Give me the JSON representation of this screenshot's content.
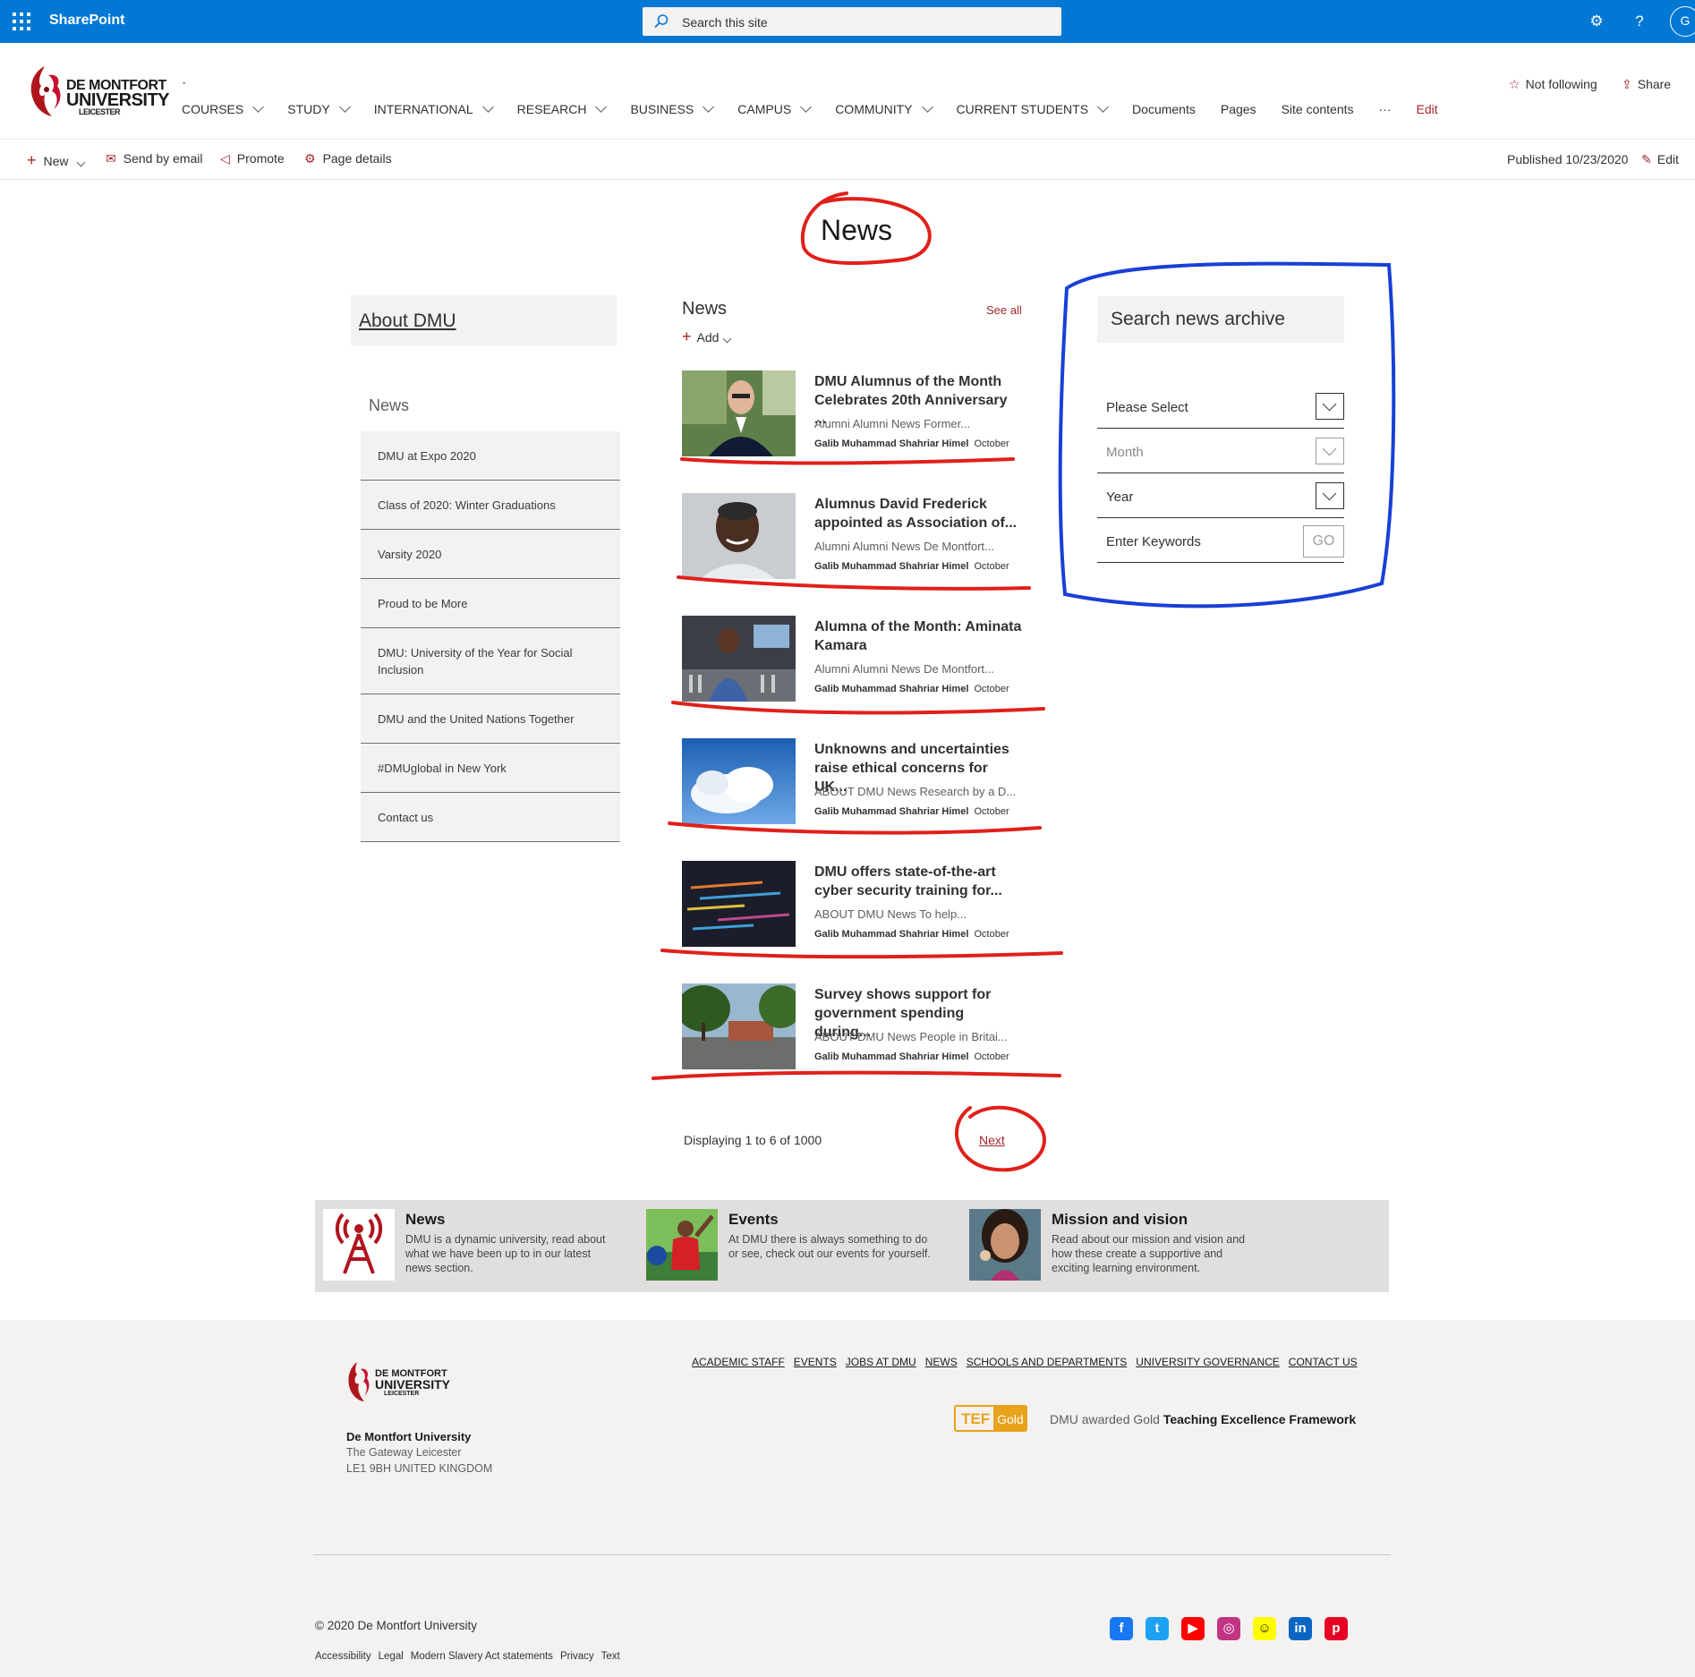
{
  "suite": {
    "app_name": "SharePoint",
    "search_placeholder": "Search this site",
    "settings_icon": "gear-icon",
    "help_label": "?",
    "avatar_initial": "G"
  },
  "site": {
    "logo_line1": "DE MONTFORT",
    "logo_line2": "UNIVERSITY",
    "logo_line3": "LEICESTER",
    "dot": "·",
    "nav": [
      {
        "label": "COURSES",
        "dropdown": true
      },
      {
        "label": "STUDY",
        "dropdown": true
      },
      {
        "label": "INTERNATIONAL",
        "dropdown": true
      },
      {
        "label": "RESEARCH",
        "dropdown": true
      },
      {
        "label": "BUSINESS",
        "dropdown": true
      },
      {
        "label": "CAMPUS",
        "dropdown": true
      },
      {
        "label": "COMMUNITY",
        "dropdown": true
      },
      {
        "label": "CURRENT STUDENTS",
        "dropdown": true
      },
      {
        "label": "Documents",
        "dropdown": false
      },
      {
        "label": "Pages",
        "dropdown": false
      },
      {
        "label": "Site contents",
        "dropdown": false
      },
      {
        "label": "···",
        "dropdown": false
      },
      {
        "label": "Edit",
        "dropdown": false
      }
    ],
    "follow_label": "Not following",
    "share_label": "Share"
  },
  "commandbar": {
    "new_label": "New",
    "email_label": "Send by email",
    "promote_label": "Promote",
    "details_label": "Page details",
    "published": "Published 10/23/2020",
    "edit_label": "Edit"
  },
  "page": {
    "title": "News"
  },
  "leftnav": {
    "about_label": "About DMU",
    "section_title": "News",
    "items": [
      "DMU at Expo 2020",
      "Class of 2020: Winter Graduations",
      "Varsity 2020",
      "Proud to be More",
      "DMU: University of the Year for Social Inclusion",
      "DMU and the United Nations Together",
      "#DMUglobal in New York",
      "Contact us"
    ]
  },
  "news": {
    "heading": "News",
    "see_all": "See all",
    "add_label": "Add",
    "items": [
      {
        "title": "DMU Alumnus of the Month Celebrates 20th Anniversary ...",
        "desc": "Alumni Alumni News Former...",
        "author": "Galib Muhammad Shahriar Himel",
        "date": "October",
        "thumb": "portrait-man-glasses"
      },
      {
        "title": "Alumnus David Frederick appointed as Association of...",
        "desc": "Alumni Alumni News De Montfort...",
        "author": "Galib Muhammad Shahriar Himel",
        "date": "October",
        "thumb": "portrait-man-smiling"
      },
      {
        "title": "Alumna of the Month: Aminata Kamara",
        "desc": "Alumni Alumni News De Montfort...",
        "author": "Galib Muhammad Shahriar Himel",
        "date": "October",
        "thumb": "radio-studio"
      },
      {
        "title": "Unknowns and uncertainties raise ethical concerns for UK...",
        "desc": "ABOUT DMU News Research by a D...",
        "author": "Galib Muhammad Shahriar Himel",
        "date": "October",
        "thumb": "cloud-sky"
      },
      {
        "title": "DMU offers state-of-the-art cyber security training for...",
        "desc": "ABOUT DMU News To help...",
        "author": "Galib Muhammad Shahriar Himel",
        "date": "October",
        "thumb": "code-screen"
      },
      {
        "title": "Survey shows support for government spending during...",
        "desc": "ABOUT DMU News People in Britai...",
        "author": "Galib Muhammad Shahriar Himel",
        "date": "October",
        "thumb": "campus-trees"
      }
    ],
    "displaying": "Displaying 1 to 6 of 1000",
    "next_label": "Next"
  },
  "archive": {
    "title": "Search news archive",
    "select1": "Please Select",
    "month": "Month",
    "year": "Year",
    "keywords_label": "Enter Keywords",
    "go_label": "GO"
  },
  "promo": [
    {
      "title": "News",
      "text": "DMU is a dynamic university, read about what we have been up to in our latest news section."
    },
    {
      "title": "Events",
      "text": "At DMU there is always something to do or see, check out our events for yourself."
    },
    {
      "title": "Mission and vision",
      "text": "Read about our mission and vision and how these create a supportive and exciting learning environment."
    }
  ],
  "footer": {
    "org": "De Montfort University",
    "addr1": "The Gateway  Leicester",
    "addr2": "LE1 9BH  UNITED KINGDOM",
    "links": [
      "ACADEMIC STAFF",
      "EVENTS",
      "JOBS AT DMU",
      "NEWS",
      "SCHOOLS AND DEPARTMENTS",
      "UNIVERSITY GOVERNANCE",
      "CONTACT US"
    ],
    "tef_badge_1": "TEF",
    "tef_badge_2": "Gold",
    "tef_prefix": "DMU awarded Gold ",
    "tef_strong": "Teaching Excellence Framework",
    "copyright": "© 2020 De Montfort University",
    "legal": [
      "Accessibility",
      "Legal",
      "Modern Slavery Act statements",
      "Privacy",
      "Text"
    ],
    "socials": [
      {
        "name": "facebook-icon",
        "glyph": "f",
        "color": "#1877f2"
      },
      {
        "name": "twitter-icon",
        "glyph": "t",
        "color": "#1da1f2"
      },
      {
        "name": "youtube-icon",
        "glyph": "▶",
        "color": "#ff0000"
      },
      {
        "name": "instagram-icon",
        "glyph": "◎",
        "color": "#c13584"
      },
      {
        "name": "snapchat-icon",
        "glyph": "☺",
        "color": "#fffc00"
      },
      {
        "name": "linkedin-icon",
        "glyph": "in",
        "color": "#0a66c2"
      },
      {
        "name": "pinterest-icon",
        "glyph": "p",
        "color": "#e60023"
      }
    ]
  },
  "colors": {
    "suite_bar": "#0078d4",
    "accent": "#a4262c",
    "annotation_red": "#e0201b",
    "annotation_blue": "#1740d6"
  }
}
